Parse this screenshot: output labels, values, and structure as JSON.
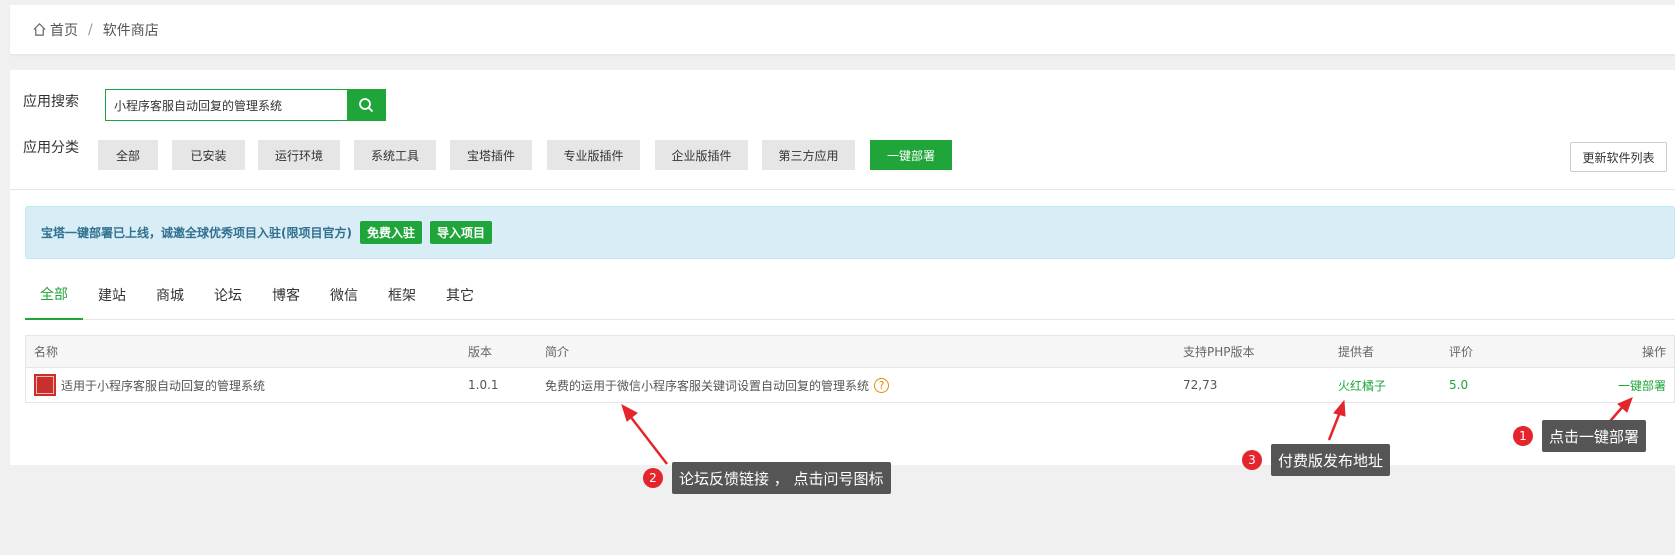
{
  "breadcrumb": {
    "home": "首页",
    "separator": "/",
    "current": "软件商店"
  },
  "search": {
    "label": "应用搜索",
    "value": "小程序客服自动回复的管理系统"
  },
  "category": {
    "label": "应用分类",
    "items": [
      "全部",
      "已安装",
      "运行环境",
      "系统工具",
      "宝塔插件",
      "专业版插件",
      "企业版插件",
      "第三方应用",
      "一键部署"
    ],
    "active_index": 8,
    "refresh_label": "更新软件列表"
  },
  "notice": {
    "text": "宝塔一键部署已上线，诚邀全球优秀项目入驻(限项目官方)",
    "btn1": "免费入驻",
    "btn2": "导入项目"
  },
  "tabs": {
    "items": [
      "全部",
      "建站",
      "商城",
      "论坛",
      "博客",
      "微信",
      "框架",
      "其它"
    ],
    "active_index": 0
  },
  "table": {
    "headers": {
      "name": "名称",
      "version": "版本",
      "desc": "简介",
      "php": "支持PHP版本",
      "provider": "提供者",
      "rating": "评价",
      "action": "操作"
    },
    "rows": [
      {
        "name": "适用于小程序客服自动回复的管理系统",
        "version": "1.0.1",
        "desc": "免费的运用于微信小程序客服关键词设置自动回复的管理系统",
        "help": "?",
        "php": "72,73",
        "provider": "火红橘子",
        "rating": "5.0",
        "action": "一键部署"
      }
    ]
  },
  "annotations": [
    {
      "number": "1",
      "text": "点击一键部署"
    },
    {
      "number": "2",
      "text": "论坛反馈链接 ， 点击问号图标"
    },
    {
      "number": "3",
      "text": "付费版发布地址"
    }
  ],
  "colors": {
    "accent": "#20a53a",
    "badge": "#e4262c",
    "tooltip": "#555555",
    "notice_bg": "#d9edf7"
  }
}
